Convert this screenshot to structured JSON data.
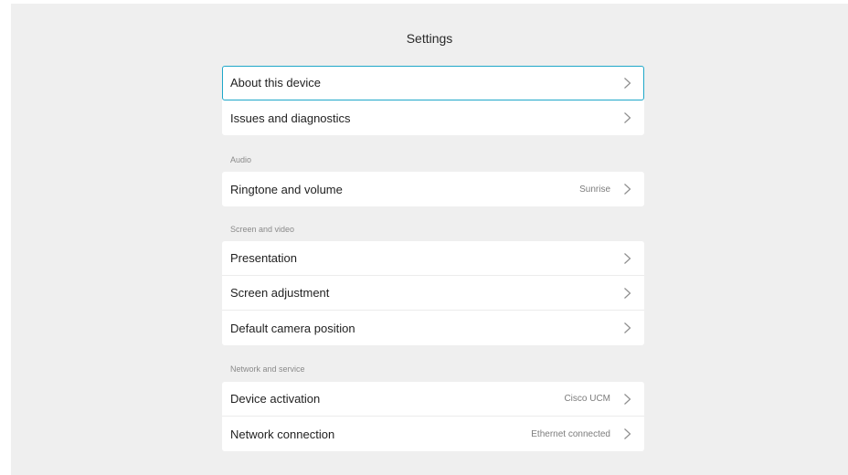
{
  "header": {
    "title": "Settings"
  },
  "groups": {
    "general": {
      "items": [
        {
          "label": "About this device",
          "value": ""
        },
        {
          "label": "Issues and diagnostics",
          "value": ""
        }
      ]
    },
    "audio": {
      "title": "Audio",
      "items": [
        {
          "label": "Ringtone and volume",
          "value": "Sunrise"
        }
      ]
    },
    "screen": {
      "title": "Screen and video",
      "items": [
        {
          "label": "Presentation",
          "value": ""
        },
        {
          "label": "Screen adjustment",
          "value": ""
        },
        {
          "label": "Default camera position",
          "value": ""
        }
      ]
    },
    "network": {
      "title": "Network and service",
      "items": [
        {
          "label": "Device activation",
          "value": "Cisco UCM"
        },
        {
          "label": "Network connection",
          "value": "Ethernet connected"
        }
      ]
    }
  },
  "icons": {
    "row_arrow": "chevron-right-icon"
  },
  "colors": {
    "selection_outline": "#1ea7c9",
    "background": "#efefef"
  }
}
